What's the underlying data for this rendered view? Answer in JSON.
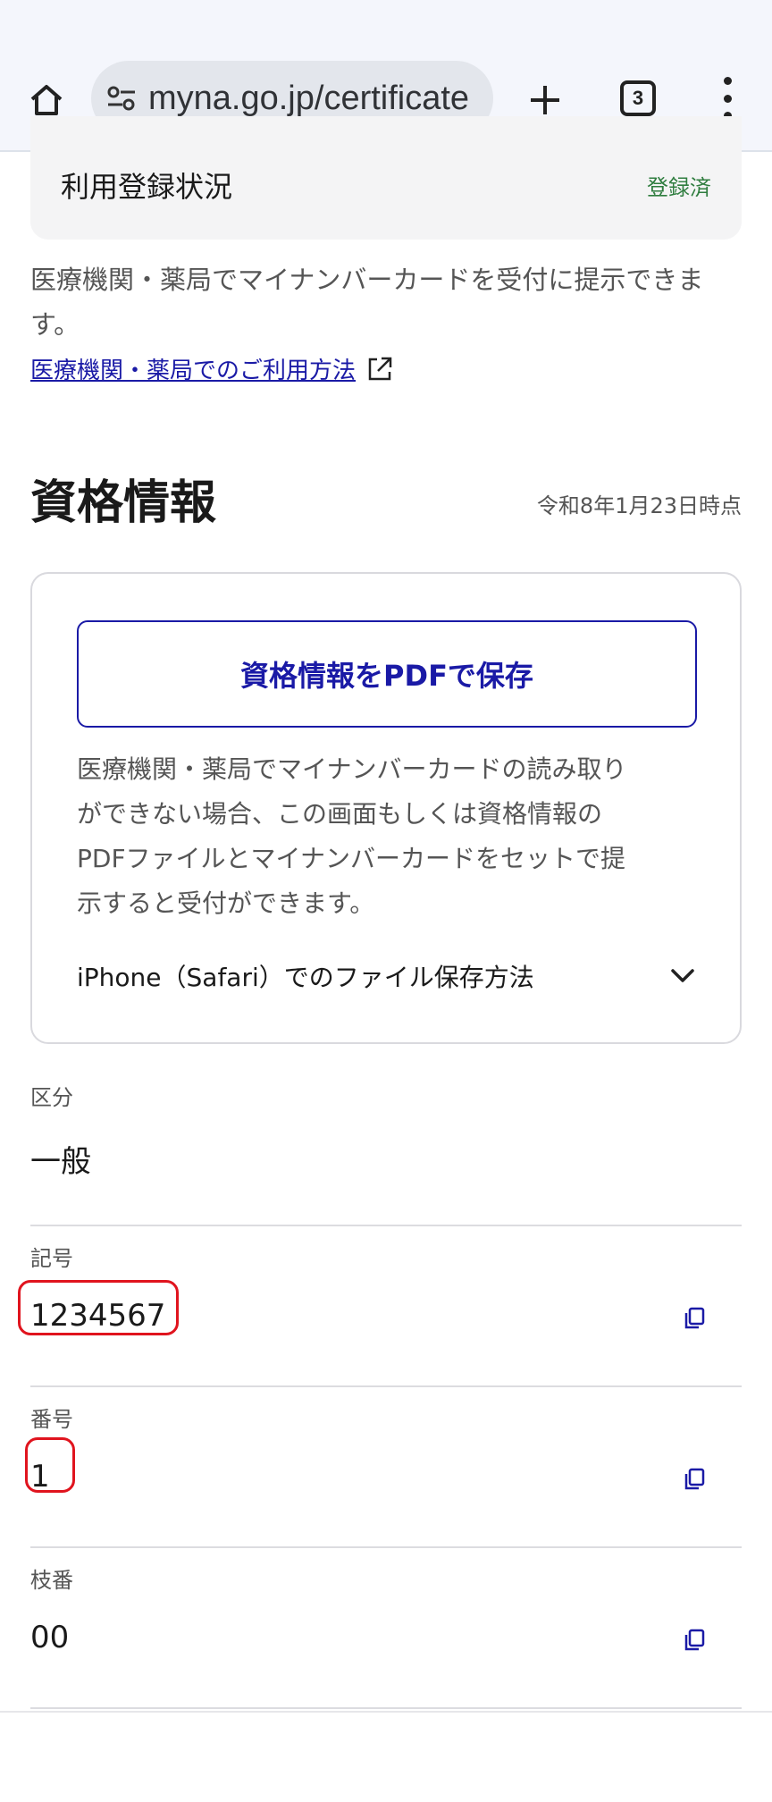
{
  "browser": {
    "url": "myna.go.jp/certificate",
    "tab_count": "3",
    "icons": [
      "home-icon",
      "site-settings-icon",
      "new-tab-icon",
      "tab-switcher-icon",
      "more-menu-icon"
    ]
  },
  "registration": {
    "label": "利用登録状況",
    "status": "登録済",
    "status_color": "#2f7d3f"
  },
  "note": {
    "line1": "医療機関・薬局でマイナンバーカードを受付に提示できま",
    "line2": "す。"
  },
  "usage_link": {
    "label": "医療機関・薬局でのご利用方法"
  },
  "section": {
    "title": "資格情報",
    "as_of": "令和8年1月23日時点"
  },
  "pdf": {
    "button_label": "資格情報をPDFで保存",
    "desc_line1": "医療機関・薬局でマイナンバーカードの読み取り",
    "desc_line2": "ができない場合、この画面もしくは資格情報の",
    "desc_line3": "PDFファイルとマイナンバーカードをセットで提",
    "desc_line4": "示すると受付ができます。",
    "accordion_label": "iPhone（Safari）でのファイル保存方法"
  },
  "fields": {
    "kubun": {
      "label": "区分",
      "value": "一般"
    },
    "kigou": {
      "label": "記号",
      "value": "1234567"
    },
    "bangou": {
      "label": "番号",
      "value": "1"
    },
    "edaban": {
      "label": "枝番",
      "value": "00"
    }
  },
  "colors": {
    "accent": "#1a1aa6",
    "highlight": "#e0141e"
  }
}
